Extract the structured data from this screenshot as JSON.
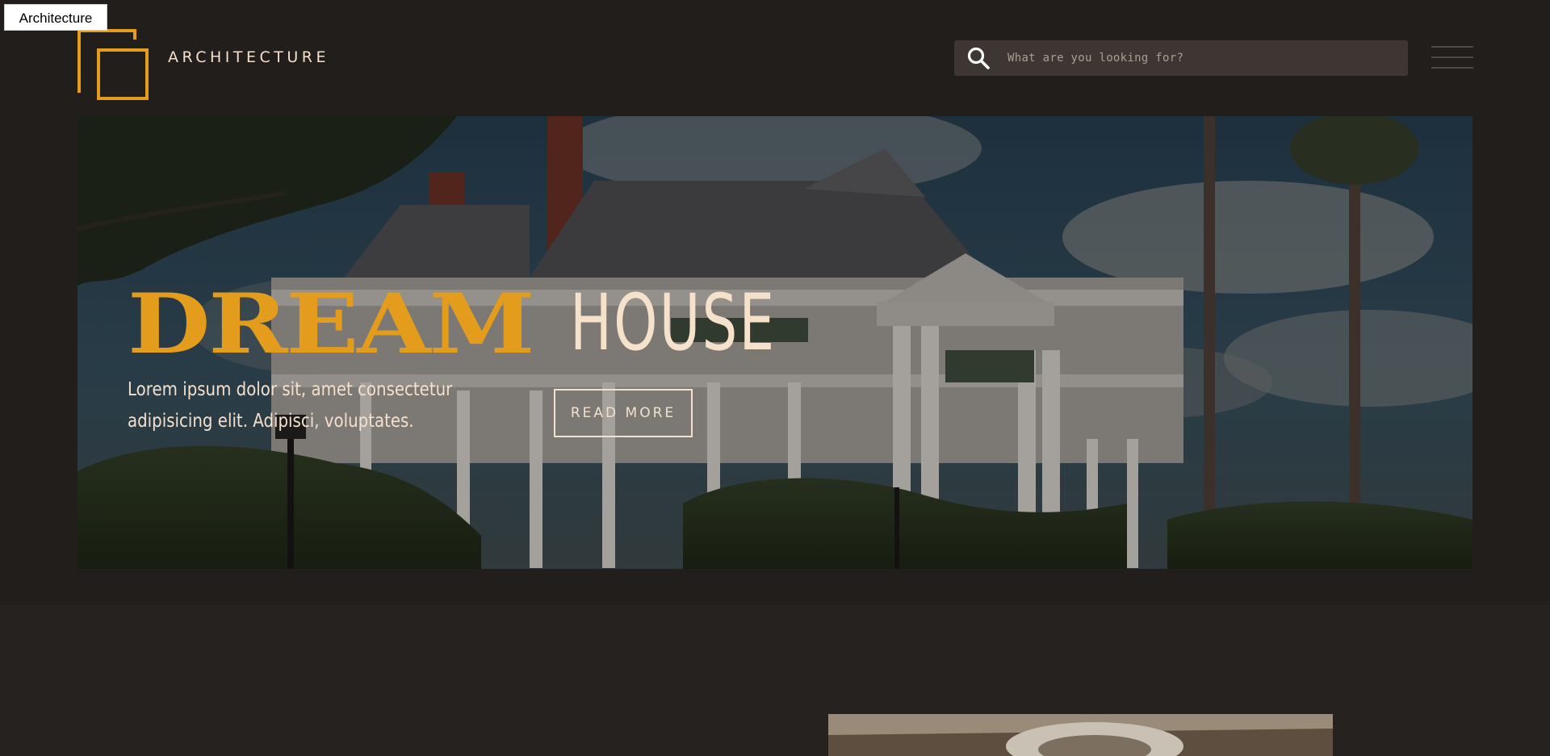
{
  "skip_link": {
    "label": "Architecture"
  },
  "brand": {
    "name": "ARCHITECTURE"
  },
  "search": {
    "placeholder": "What are you looking for?",
    "value": ""
  },
  "menu": {
    "icon": "hamburger-menu-icon"
  },
  "hero": {
    "title_bold": "DREAM",
    "title_light": "HOUSE",
    "description": "Lorem ipsum dolor sit, amet consectetur adipisicing elit. Adipisci, voluptates.",
    "button_label": "READ MORE",
    "image": "mansion-photo"
  },
  "colors": {
    "background": "#211e1b",
    "accent": "#e39c1b",
    "text": "#f3e1ce",
    "search_bg": "#3e3632"
  }
}
